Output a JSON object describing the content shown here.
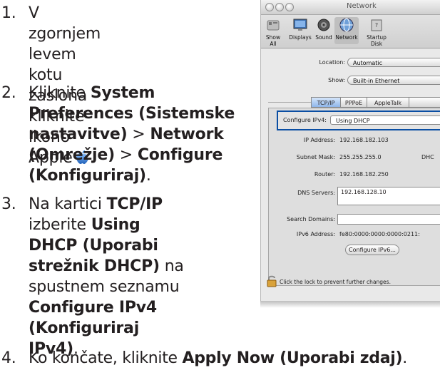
{
  "instructions": {
    "step1": {
      "num": "1.",
      "line1": "V zgornjem levem kotu",
      "line2": "zaslona kliknite ikono",
      "line3": "Apple"
    },
    "step2": {
      "num": "2.",
      "kliknite": "Kliknite",
      "sysprefs": "System Preferences (Sistemske nastavitve)",
      "sep1": ">",
      "network": "Network (Omrežje)",
      "sep2": ">",
      "configure": "Configure (Konfiguriraj)",
      "end": "."
    },
    "step3": {
      "num": "3.",
      "na_kartici": "Na kartici",
      "tcpip": "TCP/IP",
      "izberite": "izberite",
      "using_dhcp": "Using DHCP (Uporabi strežnik DHCP)",
      "na_spustnem": "na spustnem seznamu",
      "configure_ipv4": "Configure IPv4 (Konfiguriraj IPv4)",
      "end": "."
    },
    "step4": {
      "num": "4.",
      "text": "Ko končate, kliknite",
      "apply": "Apply Now (Uporabi zdaj)",
      "end": "."
    }
  },
  "window": {
    "title": "Network",
    "toolbar": [
      {
        "label": "Show All",
        "icon": "show-all-icon"
      },
      {
        "label": "Displays",
        "icon": "displays-icon"
      },
      {
        "label": "Sound",
        "icon": "sound-icon"
      },
      {
        "label": "Network",
        "icon": "network-icon"
      },
      {
        "label": "Startup Disk",
        "icon": "startup-disk-icon"
      }
    ],
    "location": {
      "label": "Location:",
      "value": "Automatic"
    },
    "show": {
      "label": "Show:",
      "value": "Built-in Ethernet"
    },
    "tabs": [
      "TCP/IP",
      "PPPoE",
      "AppleTalk"
    ],
    "configure_ipv4": {
      "label": "Configure IPv4:",
      "value": "Using DHCP"
    },
    "ip_address": {
      "label": "IP Address:",
      "value": "192.168.182.103"
    },
    "subnet_mask": {
      "label": "Subnet Mask:",
      "value": "255.255.255.0",
      "extra": "DHC"
    },
    "router": {
      "label": "Router:",
      "value": "192.168.182.250"
    },
    "dns_servers": {
      "label": "DNS Servers:",
      "value": "192.168.128.10"
    },
    "search_domains": {
      "label": "Search Domains:",
      "value": ""
    },
    "ipv6_address": {
      "label": "IPv6 Address:",
      "value": "fe80:0000:0000:0000:0211:"
    },
    "configure_ipv6_button": "Configure IPv6...",
    "lock_text": "Click the lock to prevent further changes."
  },
  "colors": {
    "highlight_border": "#0a4ea3",
    "apple_blue": "#2f7fd8"
  }
}
